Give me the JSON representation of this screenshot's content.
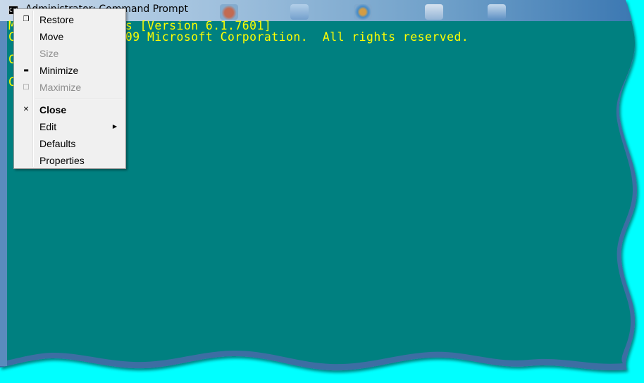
{
  "window": {
    "title": "Administrator: Command Prompt",
    "system_icon": "cmd-icon"
  },
  "console": {
    "lines": [
      "Microsoft Windows [Version 6.1.7601]",
      "Copyright (c) 2009 Microsoft Corporation.  All rights reserved.",
      "",
      "C:",
      "",
      "C:"
    ],
    "text_color": "#ffff00",
    "background_color": "#008080"
  },
  "desktop": {
    "background_color": "#00ffff"
  },
  "system_menu": {
    "items": [
      {
        "label": "Restore",
        "icon": "restore-icon",
        "glyph": "❐",
        "enabled": true,
        "bold": false
      },
      {
        "label": "Move",
        "icon": "",
        "glyph": "",
        "enabled": true,
        "bold": false
      },
      {
        "label": "Size",
        "icon": "",
        "glyph": "",
        "enabled": false,
        "bold": false
      },
      {
        "label": "Minimize",
        "icon": "minimize-icon",
        "glyph": "▬",
        "enabled": true,
        "bold": false
      },
      {
        "label": "Maximize",
        "icon": "maximize-icon",
        "glyph": "□",
        "enabled": false,
        "bold": false
      },
      {
        "label": "Close",
        "icon": "close-icon",
        "glyph": "✕",
        "enabled": true,
        "bold": true
      },
      {
        "label": "Edit",
        "icon": "",
        "glyph": "",
        "enabled": true,
        "bold": false,
        "submenu": true
      },
      {
        "label": "Defaults",
        "icon": "",
        "glyph": "",
        "enabled": true,
        "bold": false
      },
      {
        "label": "Properties",
        "icon": "",
        "glyph": "",
        "enabled": true,
        "bold": false
      }
    ],
    "submenu_arrow": "▶"
  }
}
